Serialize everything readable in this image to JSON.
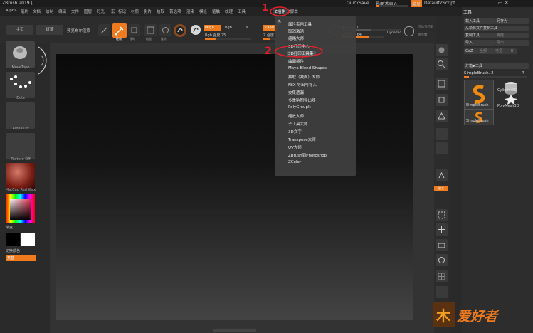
{
  "titlebar": {
    "app_title": "ZBrush 2019 [",
    "menu_label": "菜单",
    "quicksave": "QuickSave",
    "transparency": "界面透明 0",
    "menus_btn": "菜单",
    "script": "DefaultZScript"
  },
  "menubar": {
    "items": [
      "Alpha",
      "笔刷",
      "文档",
      "绘制",
      "编辑",
      "文件",
      "图层",
      "灯光",
      "宏",
      "标记",
      "材质",
      "影片",
      "拾取",
      "首选项",
      "渲染",
      "模板",
      "笔触",
      "纹理",
      "工具",
      "Z插件",
      "Z脚本"
    ]
  },
  "toolbar": {
    "home": "主页",
    "lightbox": "灯箱",
    "preview": "预览布尔渲染",
    "edit": "编辑",
    "draw": "绘制",
    "move": "移动",
    "scale": "缩放",
    "rotate": "旋转",
    "mrgb": "Mrgb",
    "rgb": "Rgb",
    "m": "M",
    "zadd": "Zadd",
    "zsub": "Zsub",
    "rgb_intensity": "Rgb 强度 25",
    "z_intensity": "Z 强度 25",
    "focal_shift": "焦点衰减 0",
    "draw_size": "绘制大小 64",
    "dynamic": "Dynamic",
    "active_points": "活动顶点数",
    "total_points": "总点数"
  },
  "left_shelf": {
    "brush": "MoveTopo",
    "stroke": "Dots",
    "alpha": "Alpha Off",
    "texture": "Texture Off",
    "material": "MatCap Red Wax",
    "gradient": "渐变",
    "switch_color": "切换颜色",
    "alternate": "交替"
  },
  "annotations": {
    "one": "1",
    "two": "2"
  },
  "dropdown": {
    "items": [
      "属性实用工具",
      "取消激活",
      "缩略大师",
      "3D打印中心",
      "3D打印工具集",
      "曲面插件",
      "Maya Blend Shapes",
      "抽取（减面）大师",
      "FBX 导出与导入",
      "交集遗漏",
      "多重贴图导出器",
      "PolyGroupIt",
      "缩放大师",
      "子工具大师",
      "3D文字",
      "Transpose大师",
      "UV大师",
      "ZBrush到Photoshop",
      "ZColor"
    ],
    "highlighted_index": 4
  },
  "right_toolbar": {
    "labels": [
      "滚动",
      "缩放",
      "实际大小",
      "适配",
      "透视",
      "地面",
      "本地",
      "框架",
      "移动",
      "缩放",
      "旋转",
      "多边形线框",
      "透明",
      "独显",
      "X光"
    ],
    "zoom_label": "放大"
  },
  "tool_panel": {
    "title": "工具",
    "load_tool": "载入工具",
    "save_as": "另存为",
    "copy_tool": "从项目文件复制工具",
    "clone": "复制工具",
    "make_polymesh": "克隆",
    "import": "导入",
    "export": "导出",
    "goz": "GoZ",
    "all": "全部",
    "visible": "可见",
    "r": "R",
    "lightbox_tools": "灯箱▶工具",
    "current_tool": "SimpleBrush. 2",
    "r2": "R",
    "tool_items": [
      "SimpleBrush",
      "Cylinder3D",
      "PolyMesh3D",
      "SimpleBrush"
    ]
  },
  "watermark": {
    "text": "爱好者",
    "logo_char": "木"
  },
  "colors": {
    "accent": "#f07a1e",
    "annotation": "#e0202a"
  }
}
